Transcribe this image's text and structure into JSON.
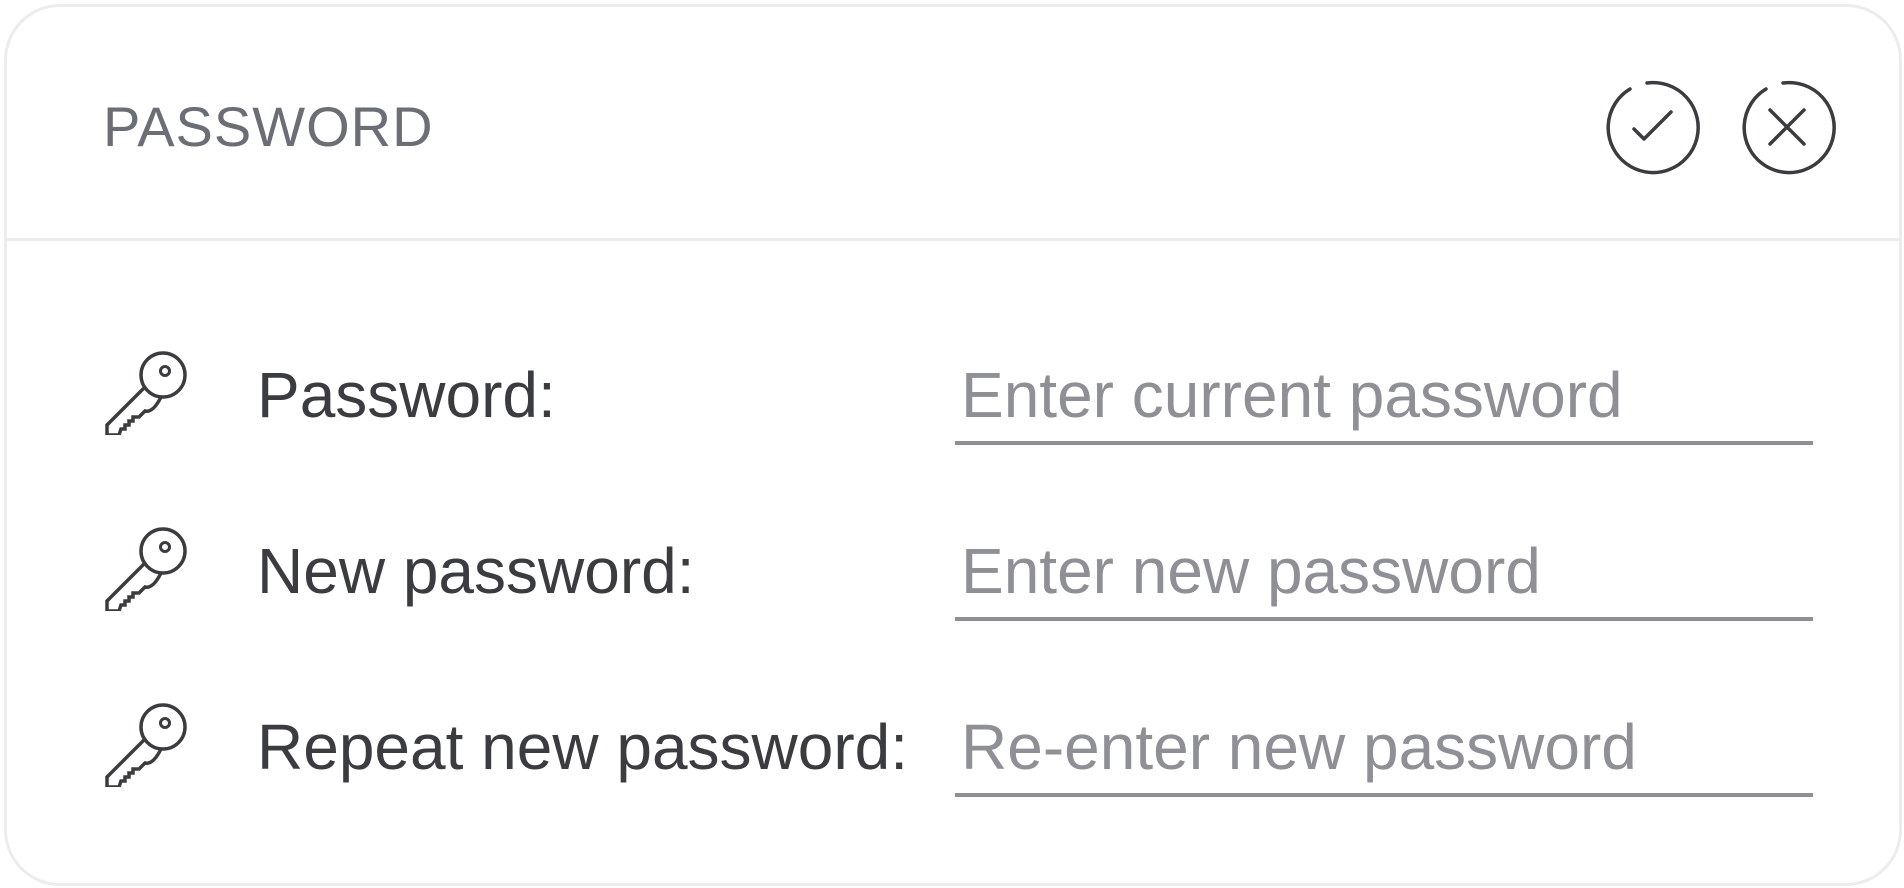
{
  "dialog": {
    "title": "PASSWORD",
    "confirm_icon": "check-circle-icon",
    "close_icon": "close-circle-icon"
  },
  "fields": [
    {
      "icon": "key-icon",
      "label": "Password:",
      "value": "",
      "placeholder": "Enter current password"
    },
    {
      "icon": "key-icon",
      "label": "New password:",
      "value": "",
      "placeholder": "Enter new password"
    },
    {
      "icon": "key-icon",
      "label": "Repeat new password:",
      "value": "",
      "placeholder": "Re-enter new password"
    }
  ],
  "colors": {
    "text": "#3b3c40",
    "title": "#6b6e74",
    "placeholder": "#8e9096",
    "border": "#ececec",
    "underline": "#8e9095"
  }
}
